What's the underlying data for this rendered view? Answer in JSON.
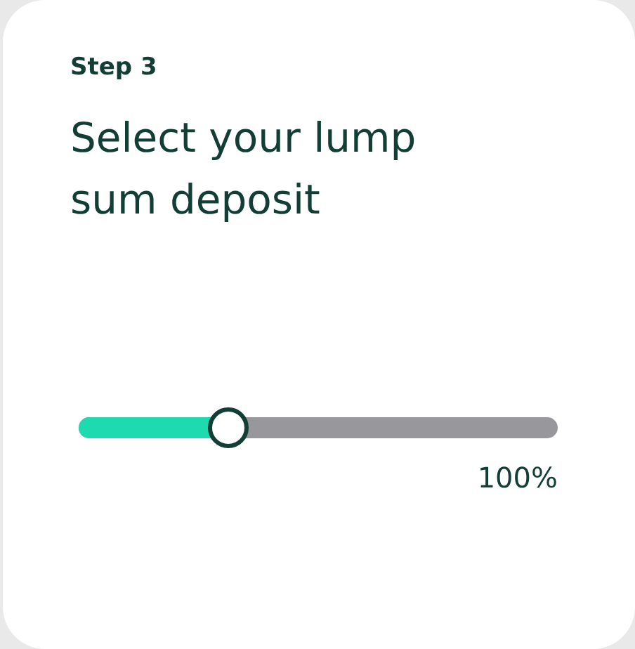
{
  "step": "Step 3",
  "title": "Select your lump sum deposit",
  "slider": {
    "level": 0.31,
    "reading": "100%"
  }
}
